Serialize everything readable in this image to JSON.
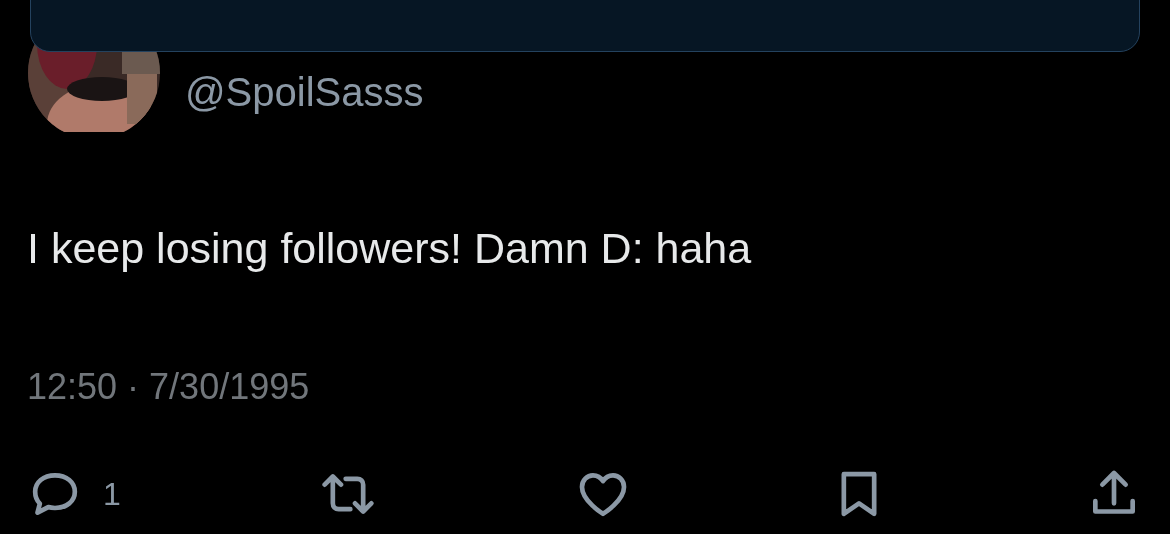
{
  "author": {
    "handle": "@SpoilSasss"
  },
  "tweet": {
    "text": "I keep losing followers! Damn D: haha",
    "timestamp": "12:50 · 7/30/1995"
  },
  "actions": [
    {
      "kind": "reply",
      "count": "1"
    },
    {
      "kind": "retweet"
    },
    {
      "kind": "like"
    },
    {
      "kind": "bookmark"
    },
    {
      "kind": "share"
    }
  ]
}
